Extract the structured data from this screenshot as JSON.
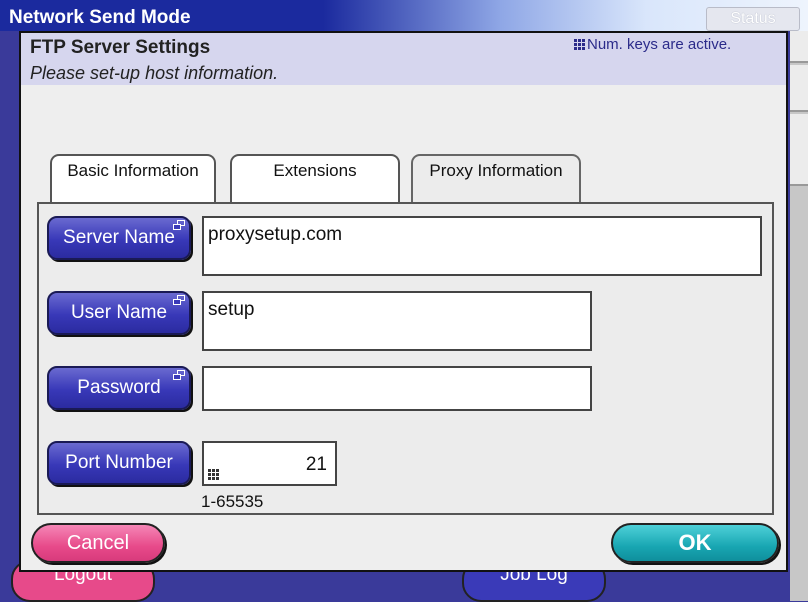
{
  "app": {
    "title": "Network Send Mode",
    "status_label": "Status",
    "logout_label": "Logout",
    "joblog_label": "Job Log"
  },
  "dialog": {
    "title": "FTP Server Settings",
    "subtitle": "Please set-up host information.",
    "numkeys_notice": "Num. keys are active."
  },
  "tabs": [
    {
      "label": "Basic Information",
      "active": false
    },
    {
      "label": "Extensions",
      "active": false
    },
    {
      "label": "Proxy Information",
      "active": true
    }
  ],
  "fields": {
    "server_name": {
      "label": "Server Name",
      "value": "proxysetup.com"
    },
    "user_name": {
      "label": "User Name",
      "value": "setup"
    },
    "password": {
      "label": "Password",
      "value": ""
    },
    "port_number": {
      "label": "Port Number",
      "value": "21",
      "range": "1-65535"
    }
  },
  "buttons": {
    "cancel": "Cancel",
    "ok": "OK"
  },
  "colors": {
    "accent_blue": "#3838b8",
    "cancel_pink": "#e74a8a",
    "ok_teal": "#18a6b2",
    "header_lavender": "#d6d6ee"
  }
}
